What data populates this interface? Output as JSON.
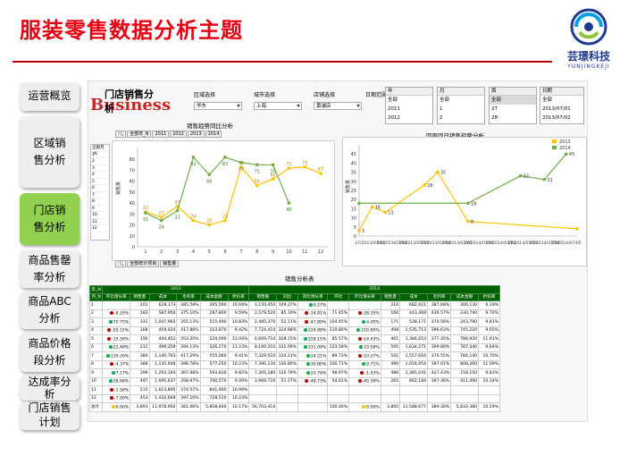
{
  "header": {
    "title": "服装零售数据分析主题",
    "logo_name": "芸璟科技",
    "logo_sub": "YUNJINGKEJI"
  },
  "sidebar": {
    "items": [
      {
        "label": "运营概览"
      },
      {
        "label": "区域销售分析"
      },
      {
        "label": "门店销售分析"
      },
      {
        "label": "商品售罄率分析"
      },
      {
        "label": "商品ABC分析"
      },
      {
        "label": "商品价格段分析"
      },
      {
        "label": "达成率分析"
      },
      {
        "label": "门店销售计划"
      }
    ]
  },
  "dashboard": {
    "logo_big": "Business",
    "logo_small": "门店销售分析",
    "filters": {
      "region_label": "区域选择",
      "region_value": "华东",
      "city_label": "城市选择",
      "city_value": "上海",
      "store_label": "店铺选择",
      "store_value": "黄浦店",
      "date_range_label": "日期范围",
      "year_header": "年",
      "year_options": [
        "全部",
        "2011",
        "2012"
      ],
      "month_header": "月",
      "month_options": [
        "全部",
        "1",
        "2"
      ],
      "week_header": "周",
      "week_options": [
        "全部",
        "27",
        "28"
      ],
      "date_header": "日期",
      "date_options": [
        "全部",
        "2013/07/01",
        "2013/07/02"
      ]
    },
    "left_chart": {
      "title": "销售趋势同比分析",
      "year_tabs": [
        "全部年_N",
        "2011",
        "2012",
        "2013",
        "2014"
      ],
      "bottom_tabs": [
        "全部统计项目",
        "销售量"
      ],
      "side_list_header": "全部月_N"
    },
    "right_chart": {
      "title": "同周同日销售趋势分析"
    },
    "sales_table": {
      "title": "销售分析表",
      "year_2013": "2013",
      "year_2014": "2014",
      "corner_top": "年_N",
      "corner_bottom": "月_N",
      "columns": [
        "环比增长率",
        "销售量",
        "成本",
        "毛利率",
        "成本金额",
        "折扣率"
      ],
      "columns_2013": [
        "环比增长率",
        "销售量",
        "成本",
        "毛利率",
        "成本金额",
        "折扣率"
      ],
      "mid_columns": [
        "销售额",
        "同比",
        "同比增长率",
        "环比"
      ],
      "rows": [
        {
          "m": "1",
          "a": "",
          "b": "201",
          "c": "628,173",
          "d": "385.59%",
          "e": "305,590",
          "f": "10.04%",
          "g": "3,150,450",
          "h": "109.27%",
          "i": "9.27%",
          "j": "",
          "k": "",
          "l": "216",
          "n": "682,921",
          "o": "387.68%",
          "p": "306,130",
          "q": "9.19%",
          "dot_a": "",
          "dot_i": "g",
          "dot_k": ""
        },
        {
          "m": "2",
          "a": "-8.25%",
          "b": "183",
          "c": "587,950",
          "d": "375.10%",
          "e": "287,800",
          "f": "9.59%",
          "g": "2,579,520",
          "h": "85.19%",
          "i": "-14.81%",
          "j": "71.45%",
          "k": "-28.35%",
          "l": "166",
          "n": "443,469",
          "o": "436.57%",
          "p": "230,740",
          "q": "9.70%",
          "dot_a": "r",
          "dot_i": "r",
          "dot_k": "r"
        },
        {
          "m": "3",
          "a": "70.75%",
          "b": "331",
          "c": "1,047,965",
          "d": "355.13%",
          "e": "515,490",
          "f": "10.83%",
          "g": "2,485,370",
          "h": "52.11%",
          "i": "-47.89%",
          "j": "104.45%",
          "k": "4.45%",
          "l": "171",
          "n": "528,171",
          "o": "370.56%",
          "p": "243,790",
          "q": "9.81%",
          "dot_a": "g",
          "dot_i": "r",
          "dot_k": "g"
        },
        {
          "m": "4",
          "a": "-50.15%",
          "b": "168",
          "c": "459,024",
          "d": "417.88%",
          "e": "223,870",
          "f": "9.42%",
          "g": "7,724,410",
          "h": "324.88%",
          "i": "224.88%",
          "j": "310.80%",
          "k": "210.80%",
          "l": "498",
          "n": "1,535,713",
          "o": "396.63%",
          "p": "745,220",
          "q": "9.65%",
          "dot_a": "r",
          "dot_i": "g",
          "dot_k": "g"
        },
        {
          "m": "5",
          "a": "-15.56%",
          "b": "156",
          "c": "444,452",
          "d": "353.20%",
          "e": "220,090",
          "f": "11.04%",
          "g": "6,609,710",
          "h": "328.15%",
          "i": "228.15%",
          "j": "85.57%",
          "k": "-14.43%",
          "l": "461",
          "n": "1,384,653",
          "o": "377.35%",
          "p": "786,920",
          "q": "11.91%",
          "dot_a": "r",
          "dot_i": "g",
          "dot_k": "r"
        },
        {
          "m": "6",
          "a": "22.48%",
          "b": "212",
          "c": "499,259",
          "d": "394.13%",
          "e": "326,270",
          "f": "13.23%",
          "g": "8,160,310",
          "h": "331.09%",
          "i": "231.09%",
          "j": "123.58%",
          "k": "23.58%",
          "l": "595",
          "n": "1,634,271",
          "o": "399.80%",
          "p": "787,340",
          "q": "9.64%",
          "dot_a": "g",
          "dot_i": "g",
          "dot_k": "g"
        },
        {
          "m": "7",
          "a": "139.20%",
          "b": "380",
          "c": "1,140,763",
          "d": "417.29%",
          "e": "555,060",
          "f": "9.41%",
          "g": "7,329,510",
          "h": "124.21%",
          "i": "24.21%",
          "j": "89.73%",
          "k": "-10.27%",
          "l": "541",
          "n": "1,557,616",
          "o": "370.55%",
          "p": "784,140",
          "q": "10.70%",
          "dot_a": "g",
          "dot_i": "g",
          "dot_k": "r"
        },
        {
          "m": "8",
          "a": "-4.37%",
          "b": "388",
          "c": "1,135,948",
          "d": "396.78%",
          "e": "577,250",
          "f": "10.23%",
          "g": "7,390,130",
          "h": "130.80%",
          "i": "30.80%",
          "j": "100.71%",
          "k": "0.71%",
          "l": "490",
          "n": "1,654,954",
          "o": "397.01%",
          "p": "808,260",
          "q": "11.09%",
          "dot_a": "r",
          "dot_i": "g",
          "dot_k": "g"
        },
        {
          "m": "9",
          "a": "7.17%",
          "b": "399",
          "c": "1,293,184",
          "d": "367.68%",
          "e": "593,830",
          "f": "9.82%",
          "g": "7,305,180",
          "h": "120.79%",
          "i": "20.79%",
          "j": "98.97%",
          "k": "-1.03%",
          "l": "486",
          "n": "1,385,041",
          "o": "427.43%",
          "p": "718,150",
          "q": "9.83%",
          "dot_a": "g",
          "dot_i": "g",
          "dot_k": "r"
        },
        {
          "m": "10",
          "a": "28.68%",
          "b": "497",
          "c": "1,695,637",
          "d": "358.97%",
          "e": "700,570",
          "f": "9.00%",
          "g": "3,969,720",
          "h": "51.27%",
          "i": "-48.73%",
          "j": "54.61%",
          "k": "-45.39%",
          "l": "265",
          "n": "802,184",
          "o": "397.36%",
          "p": "411,490",
          "q": "10.34%",
          "dot_a": "g",
          "dot_i": "r",
          "dot_k": "r"
        },
        {
          "m": "11",
          "a": "-1.58%",
          "b": "515",
          "c": "1,613,895",
          "d": "374.57%",
          "e": "841,900",
          "f": "10.99%",
          "g": "",
          "h": "",
          "i": "",
          "j": "",
          "k": "",
          "l": "",
          "n": "",
          "o": "",
          "p": "",
          "q": "",
          "dot_a": "r",
          "dot_i": "",
          "dot_k": ""
        },
        {
          "m": "12",
          "a": "-7.00%",
          "b": "453",
          "c": "1,432,669",
          "d": "397.16%",
          "e": "728,510",
          "f": "10.23%",
          "g": "",
          "h": "",
          "i": "",
          "j": "",
          "k": "",
          "l": "",
          "n": "",
          "o": "",
          "p": "",
          "q": "",
          "dot_a": "r",
          "dot_i": "",
          "dot_k": ""
        },
        {
          "m": "总计",
          "a": "0.00%",
          "b": "3,893",
          "c": "11,978,950",
          "d": "381.06%",
          "e": "5,858,840",
          "f": "10.17%",
          "g": "56,703,410",
          "h": "",
          "i": "",
          "j": "100.00%",
          "k": "0.00%",
          "l": "3,892",
          "n": "11,588,677",
          "o": "389.30%",
          "p": "5,833,380",
          "q": "10.29%",
          "dot_a": "y",
          "dot_i": "",
          "dot_k": "y"
        }
      ]
    }
  },
  "chart_data": [
    {
      "type": "line",
      "title": "销售趋势同比分析",
      "ylabel": "销售量",
      "categories": [
        "1",
        "2",
        "3",
        "4",
        "5",
        "6",
        "7",
        "8",
        "9",
        "10",
        "11",
        "12"
      ],
      "ylim": [
        0,
        90
      ],
      "ticks": [
        0,
        10,
        20,
        30,
        40,
        50,
        60,
        70,
        80
      ],
      "series": [
        {
          "values": [
            32,
            27,
            37,
            24,
            20,
            24,
            73,
            56,
            62,
            72,
            73,
            67
          ],
          "color": "#ffc000",
          "labels": [
            "32",
            "27",
            "37",
            "24",
            "20",
            "24",
            "73",
            "56",
            "62",
            "72",
            "73",
            "67"
          ]
        },
        {
          "values": [
            31,
            24,
            33,
            82,
            66,
            82,
            77,
            75,
            75,
            40,
            null,
            null
          ],
          "color": "#70ad47",
          "labels": [
            "31",
            "24",
            "33",
            "82",
            "66",
            "82",
            "77",
            "75",
            "75",
            "40",
            "",
            ""
          ]
        }
      ]
    },
    {
      "type": "line",
      "title": "同周同日销售趋势分析",
      "ylabel": "销售量",
      "categories": [
        "27/2013/07/01",
        "27/2013/07/02",
        "27/2013/07/03",
        "27/2013/07/04",
        "27/2013/07/05",
        "27/2014/07/01",
        "27/2014/07/02",
        "27/2014/07/03",
        "27/2014/07/04",
        "27/2014/07/05"
      ],
      "ylim": [
        0,
        50
      ],
      "ticks": [
        0,
        5,
        10,
        15,
        20,
        25,
        30,
        35,
        40,
        45
      ],
      "legend": [
        "2013",
        "2014"
      ],
      "series": [
        {
          "name": "2013",
          "color": "#ffc000",
          "points": [
            [
              0.0,
              3
            ],
            [
              0.06,
              16
            ],
            [
              0.12,
              13
            ],
            [
              0.3,
              28
            ],
            [
              0.36,
              35
            ],
            [
              0.5,
              8
            ],
            [
              1.0,
              4
            ]
          ],
          "labels": [
            "3",
            "16",
            "13",
            "28",
            "35",
            "8",
            ""
          ]
        },
        {
          "name": "2014",
          "color": "#70ad47",
          "points": [
            [
              0.0,
              18
            ],
            [
              0.5,
              18
            ],
            [
              0.74,
              33
            ],
            [
              0.85,
              31
            ],
            [
              0.95,
              45
            ]
          ],
          "labels": [
            "",
            "18",
            "33",
            "31",
            "45"
          ]
        }
      ]
    }
  ]
}
